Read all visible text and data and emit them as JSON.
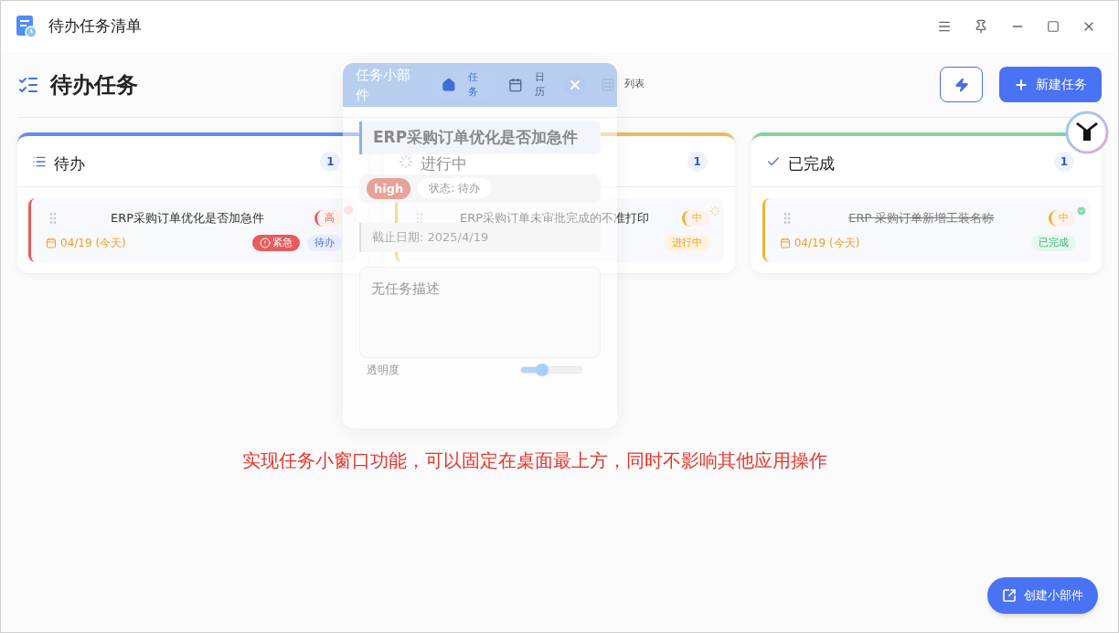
{
  "window": {
    "title": "待办任务清单"
  },
  "header": {
    "title": "待办任务",
    "view_tabs": [
      {
        "label": "列表",
        "selected": false
      }
    ],
    "new_button": "新建任务"
  },
  "columns": [
    {
      "kind": "todo",
      "title": "待办",
      "color": "#6a8ae8",
      "count": "1",
      "tasks": [
        {
          "title": "ERP采购订单优化是否加急件",
          "priority": "高",
          "color": "#e85c5c",
          "date": "04/19 (今天)",
          "urgent": "紧急",
          "status": "待办",
          "done": false
        }
      ]
    },
    {
      "kind": "doing",
      "title": "进行中",
      "color": "#f0b866",
      "count": "1",
      "tasks": [
        {
          "title": "ERP采购订单未审批完成的不准打印",
          "priority": "中",
          "color": "#f0b030",
          "status": "进行中",
          "done": false
        }
      ]
    },
    {
      "kind": "done",
      "title": "已完成",
      "color": "#86d3a0",
      "count": "1",
      "tasks": [
        {
          "title": "ERP 采购订单新增工装名称",
          "priority": "中",
          "color": "#f0b030",
          "date": "04/19 (今天)",
          "status": "已完成",
          "done": true
        }
      ]
    }
  ],
  "widget": {
    "title": "任务小部件",
    "tabs": [
      {
        "label": "任务",
        "kind": "home",
        "selected": true
      },
      {
        "label": "日历",
        "kind": "calendar",
        "selected": false
      }
    ],
    "task_title": "ERP采购订单优化是否加急件",
    "priority": "high",
    "status": "状态: 待办",
    "due": "截止日期: 2025/4/19",
    "description": {
      "placeholder": "无任务描述"
    },
    "opacity_label": "透明度",
    "opacity": {
      "level": 0.35
    }
  },
  "caption": "实现任务小窗口功能，可以固定在桌面最上方，同时不影响其他应用操作",
  "fab": "创建小部件"
}
